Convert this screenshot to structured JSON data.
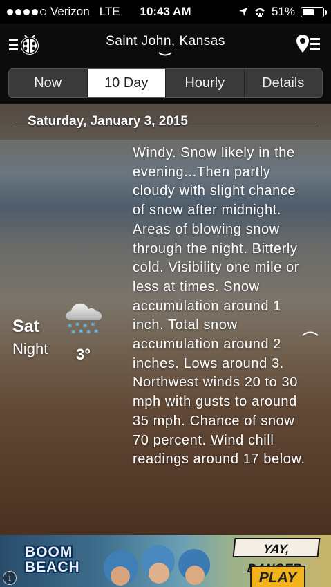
{
  "status_bar": {
    "carrier": "Verizon",
    "network": "LTE",
    "time": "10:43 AM",
    "battery": "51%",
    "battery_level": 0.51
  },
  "header": {
    "location": "Saint John, Kansas"
  },
  "tabs": [
    {
      "label": "Now",
      "active": false
    },
    {
      "label": "10 Day",
      "active": true
    },
    {
      "label": "Hourly",
      "active": false
    },
    {
      "label": "Details",
      "active": false
    }
  ],
  "forecast": {
    "date": "Saturday, January 3, 2015",
    "day": "Sat",
    "period": "Night",
    "temperature": "3°",
    "icon": "snow-cloud-icon",
    "text": "Windy. Snow likely in the evening...Then partly cloudy with slight chance of snow after midnight. Areas of blowing snow through the night. Bitterly cold. Visibility one mile or less at times. Snow accumulation around 1 inch. Total snow accumulation around 2 inches. Lows around 3. Northwest winds 20 to 30 mph with gusts to around 35 mph. Chance of snow 70 percent. Wind chill readings around 17 below."
  },
  "ad": {
    "brand": "BOOM BEACH",
    "tagline": "YAY, DANGER",
    "cta": "PLAY",
    "info": "i"
  }
}
